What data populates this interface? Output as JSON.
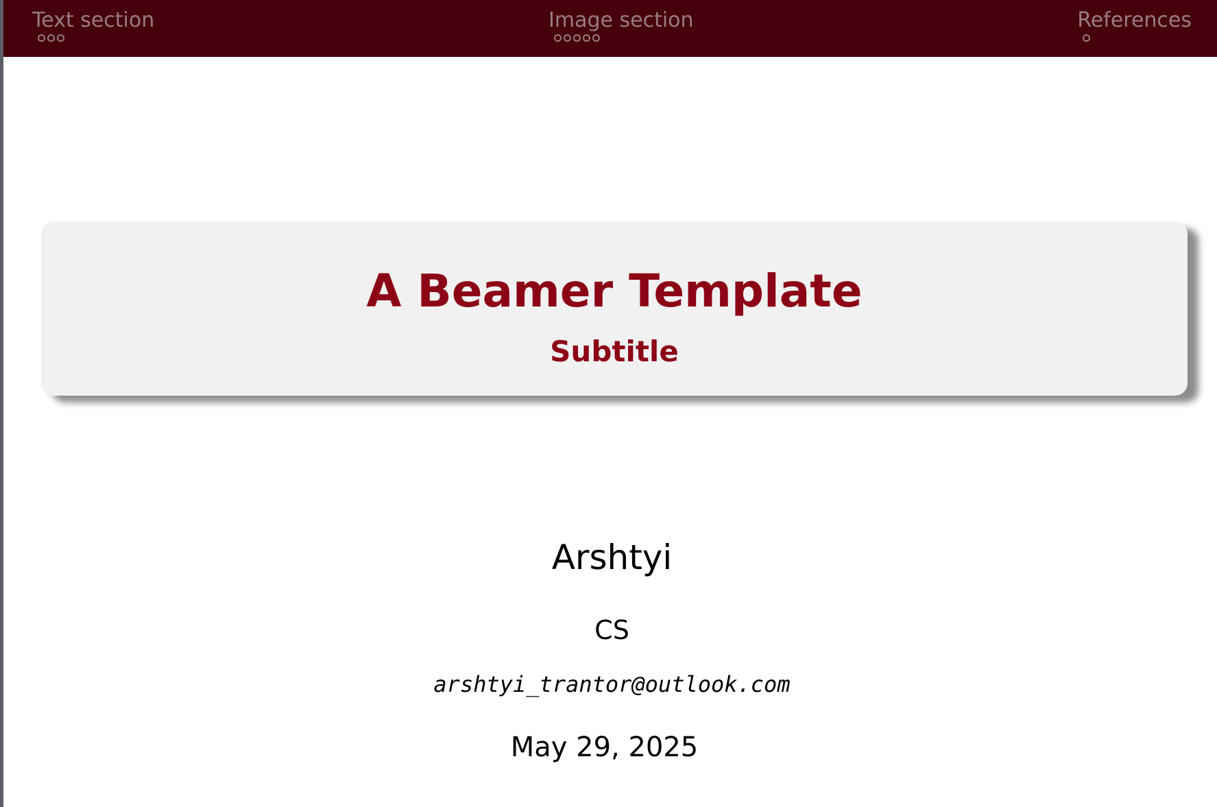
{
  "nav": {
    "sections": [
      {
        "label": "Text section",
        "dots": 3
      },
      {
        "label": "Image section",
        "dots": 5
      },
      {
        "label": "References",
        "dots": 1
      }
    ]
  },
  "slide": {
    "title": "A Beamer Template",
    "subtitle": "Subtitle",
    "author": "Arshtyi",
    "institute": "CS",
    "email": "arshtyi_trantor@outlook.com",
    "date": "May 29, 2025"
  },
  "colors": {
    "nav_background": "#45000b",
    "nav_text": "#9a7c80",
    "title": "#8c0316",
    "title_box": "#f1f1f1"
  }
}
